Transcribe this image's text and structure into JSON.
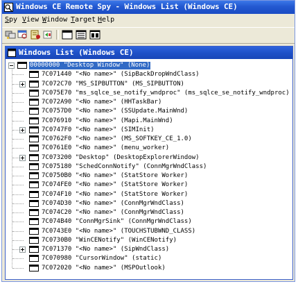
{
  "title": "Windows CE Remote Spy - Windows List (Windows CE)",
  "menu": [
    {
      "label": "Spy",
      "ul": "S",
      "rest": "py"
    },
    {
      "label": "View",
      "ul": "V",
      "rest": "iew"
    },
    {
      "label": "Window",
      "ul": "W",
      "rest": "indow"
    },
    {
      "label": "Target",
      "ul": "T",
      "rest": "arget"
    },
    {
      "label": "Help",
      "ul": "H",
      "rest": "elp"
    }
  ],
  "toolbar": {
    "buttons": [
      "connect-icon",
      "find-window-icon",
      "properties-icon",
      "refresh-icon",
      "window-list-icon",
      "messages-icon",
      "options-icon"
    ]
  },
  "child_window": {
    "title": "Windows List (Windows CE)"
  },
  "tree": {
    "root": "00000000 \"Desktop Window\" (None)",
    "items": [
      {
        "text": "7C071440 \"<No name>\" (SipBackDropWndClass)",
        "expandable": false
      },
      {
        "text": "7C072C70 \"MS_SIPBUTTON\" (MS_SIPBUTTON)",
        "expandable": true
      },
      {
        "text": "7C075E70 \"ms_sqlce_se_notify_wndproc\" (ms_sqlce_se_notify_wndproc)",
        "expandable": false
      },
      {
        "text": "7C072A90 \"<No name>\" (HHTaskBar)",
        "expandable": false
      },
      {
        "text": "7C0757D0 \"<No name>\" (SSUpdate.MainWnd)",
        "expandable": false
      },
      {
        "text": "7C076910 \"<No name>\" (Mapi.MainWnd)",
        "expandable": false
      },
      {
        "text": "7C0747F0 \"<No name>\" (SIMInit)",
        "expandable": true
      },
      {
        "text": "7C0762F0 \"<No name>\" (MS_SOFTKEY_CE_1.0)",
        "expandable": false
      },
      {
        "text": "7C0761E0 \"<No name>\" (menu_worker)",
        "expandable": false
      },
      {
        "text": "7C073200 \"Desktop\" (DesktopExplorerWindow)",
        "expandable": true
      },
      {
        "text": "7C075180 \"SchedConnNotify\" (ConnMgrWndClass)",
        "expandable": false
      },
      {
        "text": "7C0750B0 \"<No name>\" (StatStore Worker)",
        "expandable": false
      },
      {
        "text": "7C074FE0 \"<No name>\" (StatStore Worker)",
        "expandable": false
      },
      {
        "text": "7C074F10 \"<No name>\" (StatStore Worker)",
        "expandable": false
      },
      {
        "text": "7C074D30 \"<No name>\" (ConnMgrWndClass)",
        "expandable": false
      },
      {
        "text": "7C074C20 \"<No name>\" (ConnMgrWndClass)",
        "expandable": false
      },
      {
        "text": "7C074B40 \"ConnMgrSink\" (ConnMgrWndClass)",
        "expandable": false
      },
      {
        "text": "7C0743E0 \"<No name>\" (TOUCHSTUBWND_CLASS)",
        "expandable": false
      },
      {
        "text": "7C0730B0 \"WinCENotify\" (WinCENotify)",
        "expandable": false
      },
      {
        "text": "7C071370 \"<No name>\" (SipWndClass)",
        "expandable": true
      },
      {
        "text": "7C070980 \"CursorWindow\" (static)",
        "expandable": false
      },
      {
        "text": "7C072020 \"<No name>\" (MSPOutlook)",
        "expandable": false
      }
    ]
  }
}
